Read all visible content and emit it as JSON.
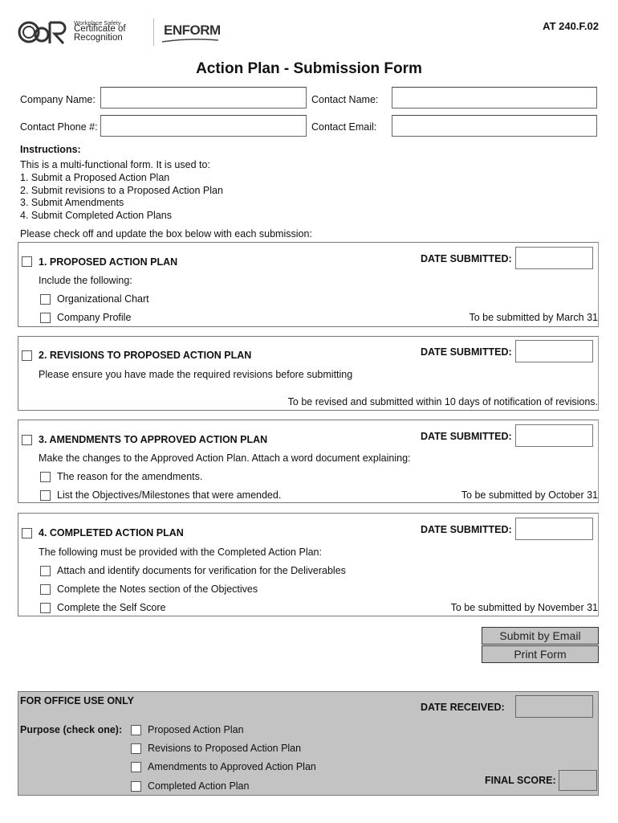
{
  "header": {
    "cor_logo_text": "COR",
    "cor_tagline_small": "Workplace Safety",
    "cor_tagline_big": "Certificate of Recognition",
    "partner_logo": "ENFORM",
    "form_code": "AT 240.F.02",
    "title": "Action Plan - Submission Form"
  },
  "contact": {
    "company_name_label": "Company Name:",
    "company_name_value": "",
    "contact_name_label": "Contact Name:",
    "contact_name_value": "",
    "contact_phone_label": "Contact Phone #:",
    "contact_phone_value": "",
    "contact_email_label": "Contact Email:",
    "contact_email_value": ""
  },
  "instructions": {
    "heading": "Instructions:",
    "lines": [
      "This is a multi-functional form. It is used to:",
      "1. Submit a Proposed Action Plan",
      "2. Submit revisions to a Proposed Action Plan",
      "3. Submit Amendments",
      "4. Submit Completed Action Plans"
    ],
    "checkoff_note": "Please check off and update the box below with each submission:"
  },
  "date_submitted_label": "DATE SUBMITTED:",
  "sections": [
    {
      "title": "1. PROPOSED ACTION PLAN",
      "checked": false,
      "description": "Include the following:",
      "items": [
        {
          "label": "Organizational Chart",
          "checked": false
        },
        {
          "label": "Company Profile",
          "checked": false
        }
      ],
      "deadline": "To be submitted by March 31",
      "date_submitted": ""
    },
    {
      "title": "2. REVISIONS TO PROPOSED ACTION PLAN",
      "checked": false,
      "description": "Please ensure you have made the required revisions before submitting",
      "items": [],
      "deadline": "To be revised and submitted within 10 days of notification of revisions.",
      "date_submitted": ""
    },
    {
      "title": "3. AMENDMENTS TO APPROVED ACTION PLAN",
      "checked": false,
      "description": "Make the changes to the Approved Action Plan. Attach a word document explaining:",
      "items": [
        {
          "label": "The reason for the amendments.",
          "checked": false
        },
        {
          "label": "List the Objectives/Milestones that were amended.",
          "checked": false
        }
      ],
      "deadline": "To be submitted by October 31",
      "date_submitted": ""
    },
    {
      "title": "4. COMPLETED ACTION PLAN",
      "checked": false,
      "description": "The following must be provided with the Completed Action Plan:",
      "items": [
        {
          "label": "Attach and identify documents for verification for the Deliverables",
          "checked": false
        },
        {
          "label": "Complete the Notes section of the Objectives",
          "checked": false
        },
        {
          "label": "Complete the Self Score",
          "checked": false
        }
      ],
      "deadline": "To be submitted by November 31",
      "date_submitted": ""
    }
  ],
  "buttons": {
    "submit_email": "Submit by Email",
    "print_form": "Print Form"
  },
  "office_use": {
    "heading": "FOR OFFICE USE ONLY",
    "date_received_label": "DATE RECEIVED:",
    "date_received_value": "",
    "purpose_label": "Purpose (check one):",
    "purpose_options": [
      {
        "label": "Proposed Action Plan",
        "checked": false
      },
      {
        "label": "Revisions to Proposed Action Plan",
        "checked": false
      },
      {
        "label": "Amendments to Approved Action Plan",
        "checked": false
      },
      {
        "label": "Completed Action Plan",
        "checked": false
      }
    ],
    "final_score_label": "FINAL SCORE:",
    "final_score_value": ""
  },
  "colors": {
    "office_bg": "#c3c3c3",
    "button_bg": "#c8c8c8",
    "border": "#777777"
  }
}
